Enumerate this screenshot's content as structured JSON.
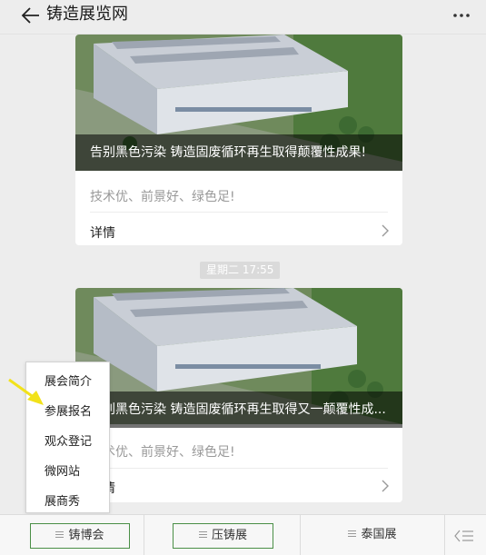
{
  "header": {
    "title": "铸造展览网"
  },
  "cards": [
    {
      "caption": "告别黑色污染 铸造固废循环再生取得颠覆性成果!",
      "description": "技术优、前景好、绿色足!",
      "detail_label": "详情"
    },
    {
      "caption": "告别黑色污染 铸造固废循环再生取得又一颠覆性成...",
      "description": "技术优、前景好、绿色足!",
      "detail_label": "详情"
    }
  ],
  "timestamp": "星期二 17:55",
  "popup_menu": {
    "items": [
      "展会简介",
      "参展报名",
      "观众登记",
      "微网站",
      "展商秀"
    ]
  },
  "bottom_menu": {
    "items": [
      "铸博会",
      "压铸展",
      "泰国展"
    ]
  },
  "colors": {
    "menu_border": "#4a8f46",
    "annotation_arrow": "#f2e21a"
  }
}
